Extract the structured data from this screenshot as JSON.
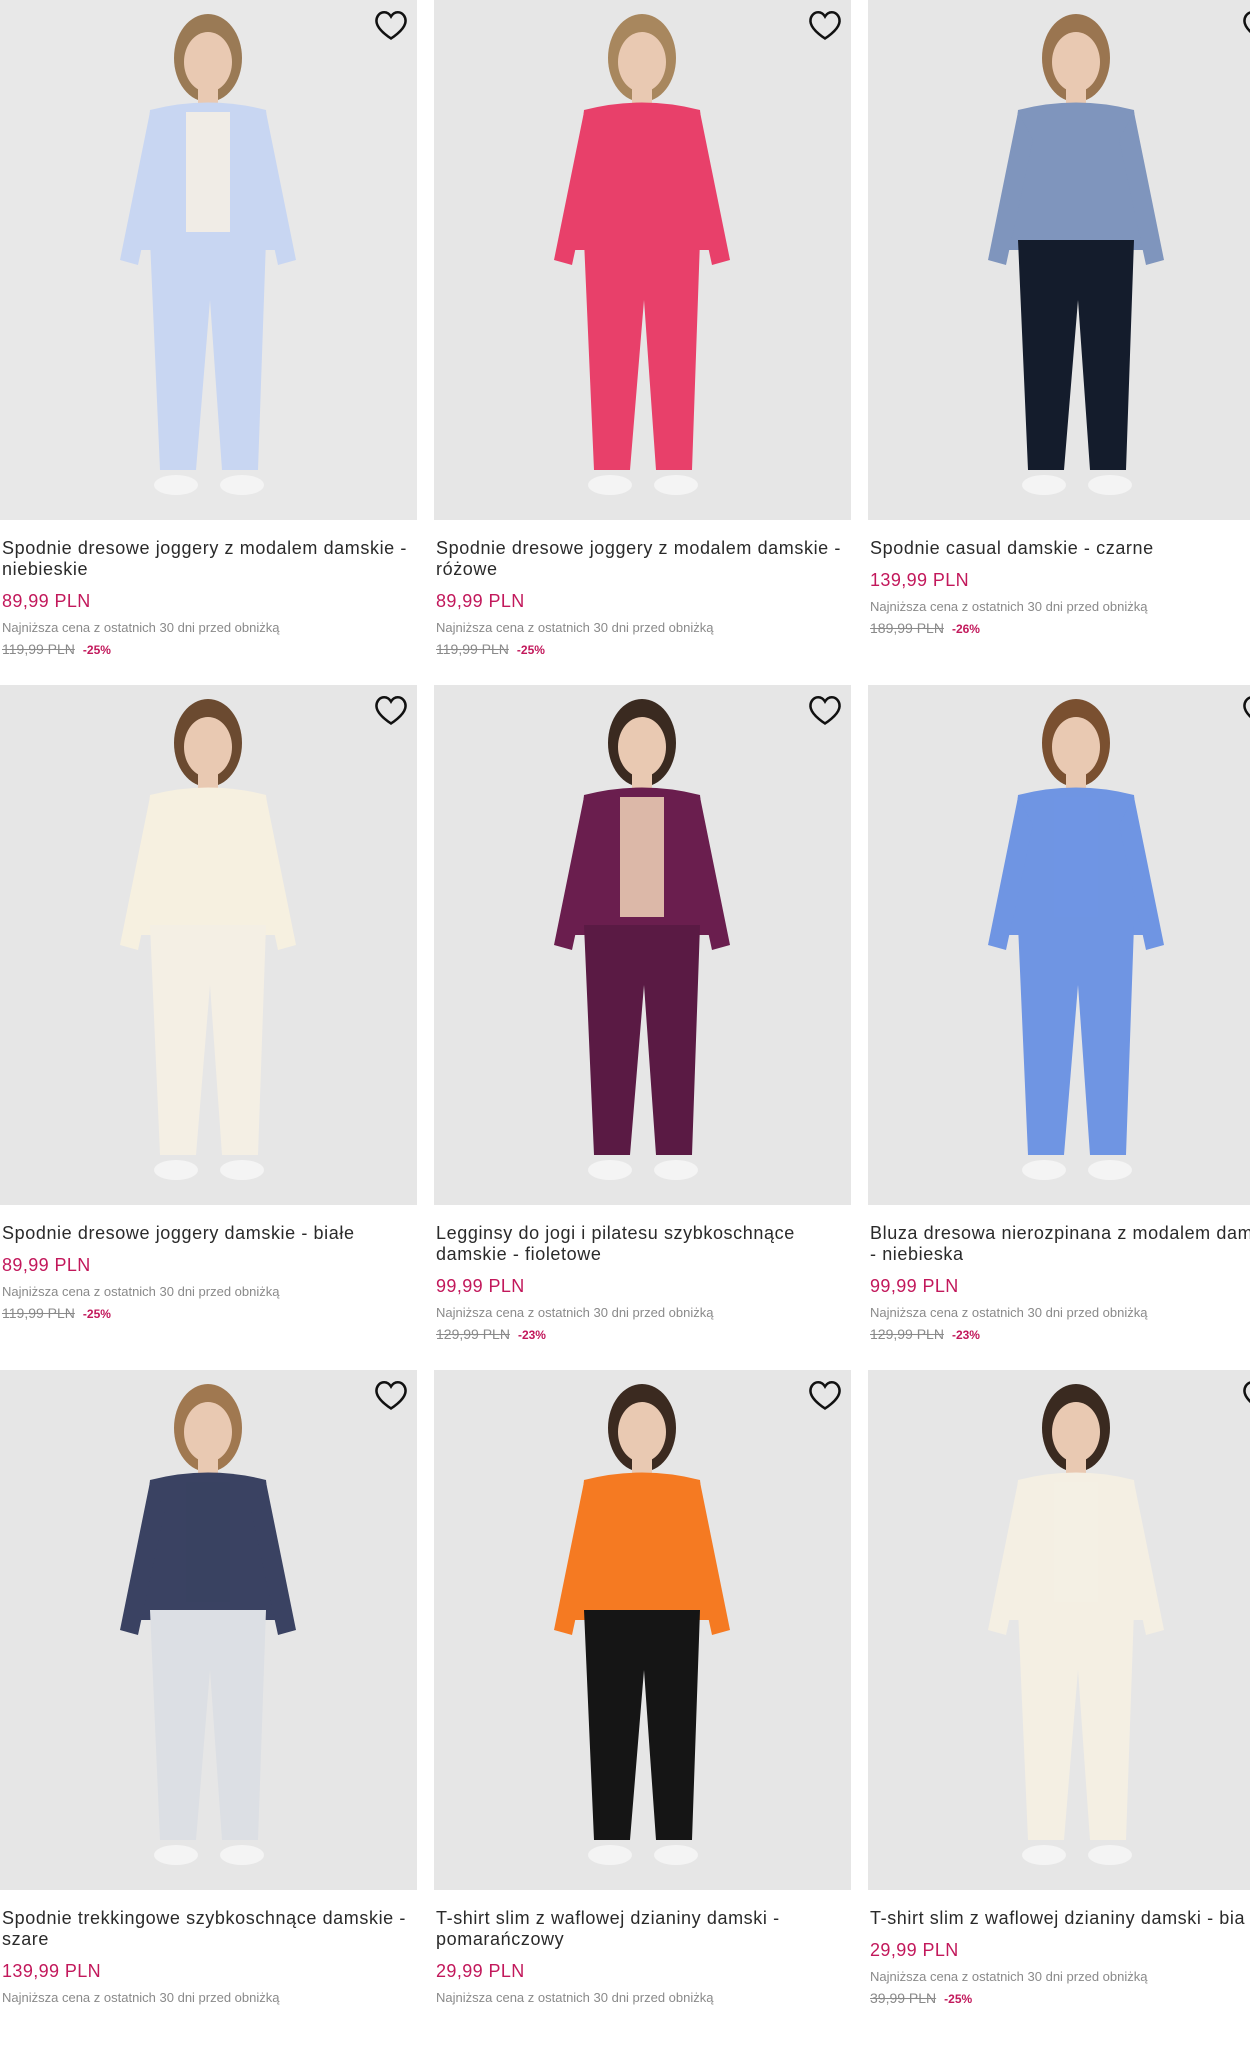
{
  "products": [
    {
      "name": "Spodnie dresowe joggery z modalem damskie - niebieskie",
      "price": "89,99 PLN",
      "lowest_label": "Najniższa cena z ostatnich 30 dni przed obniżką",
      "old_price": "119,99 PLN",
      "discount": "-25%",
      "colors": {
        "top": "#c8d6f2",
        "bottom": "#c8d6f2",
        "inner": "#f4eee4",
        "bg": "#e8e8e8",
        "hair": "#9a7a55"
      }
    },
    {
      "name": "Spodnie dresowe joggery z modalem damskie - różowe",
      "price": "89,99 PLN",
      "lowest_label": "Najniższa cena z ostatnich 30 dni przed obniżką",
      "old_price": "119,99 PLN",
      "discount": "-25%",
      "colors": {
        "top": "#e8406a",
        "bottom": "#e8406a",
        "inner": "#e8406a",
        "bg": "#e6e6e6",
        "hair": "#a8875e"
      }
    },
    {
      "name": "Spodnie casual damskie - czarne",
      "price": "139,99 PLN",
      "lowest_label": "Najniższa cena z ostatnich 30 dni przed obniżką",
      "old_price": "189,99 PLN",
      "discount": "-26%",
      "colors": {
        "top": "#7f95bd",
        "bottom": "#141c2c",
        "inner": "#7f95bd",
        "bg": "#e6e6e6",
        "hair": "#9a7550"
      }
    },
    {
      "name": "Spodnie dresowe joggery damskie - białe",
      "price": "89,99 PLN",
      "lowest_label": "Najniższa cena z ostatnich 30 dni przed obniżką",
      "old_price": "119,99 PLN",
      "discount": "-25%",
      "colors": {
        "top": "#f6f0e0",
        "bottom": "#f4efe4",
        "inner": "#f6f0e0",
        "bg": "#e6e6e6",
        "hair": "#6b4a30"
      }
    },
    {
      "name": "Legginsy do jogi i pilatesu szybkoschnące damskie - fioletowe",
      "price": "99,99 PLN",
      "lowest_label": "Najniższa cena z ostatnich 30 dni przed obniżką",
      "old_price": "129,99 PLN",
      "discount": "-23%",
      "colors": {
        "top": "#6a1e4e",
        "bottom": "#5a1a44",
        "inner": "#e9c9b2",
        "bg": "#e6e6e6",
        "hair": "#3a2a20"
      }
    },
    {
      "name": "Bluza dresowa nierozpinana z modalem damska - niebieska",
      "price": "99,99 PLN",
      "lowest_label": "Najniższa cena z ostatnich 30 dni przed obniżką",
      "old_price": "129,99 PLN",
      "discount": "-23%",
      "colors": {
        "top": "#6f95e3",
        "bottom": "#6f95e3",
        "inner": "#6f95e3",
        "bg": "#e6e6e6",
        "hair": "#7a5030"
      }
    },
    {
      "name": "Spodnie trekkingowe szybkoschnące damskie - szare",
      "price": "139,99 PLN",
      "lowest_label": "Najniższa cena z ostatnich 30 dni przed obniżką",
      "old_price": "",
      "discount": "",
      "colors": {
        "top": "#3a4262",
        "bottom": "#dcdfe4",
        "inner": "#3a4262",
        "bg": "#e6e6e6",
        "hair": "#a07850"
      }
    },
    {
      "name": "T-shirt slim z waflowej dzianiny damski - pomarańczowy",
      "price": "29,99 PLN",
      "lowest_label": "Najniższa cena z ostatnich 30 dni przed obniżką",
      "old_price": "",
      "discount": "",
      "colors": {
        "top": "#f57a22",
        "bottom": "#151515",
        "inner": "#f57a22",
        "bg": "#e6e6e6",
        "hair": "#3b2a20"
      }
    },
    {
      "name": "T-shirt slim z waflowej dzianiny damski - bia",
      "price": "29,99 PLN",
      "lowest_label": "Najniższa cena z ostatnich 30 dni przed obniżką",
      "old_price": "39,99 PLN",
      "discount": "-25%",
      "colors": {
        "top": "#f4efe3",
        "bottom": "#f4efe3",
        "inner": "#f4efe3",
        "bg": "#e6e6e6",
        "hair": "#3a2a20"
      }
    }
  ]
}
